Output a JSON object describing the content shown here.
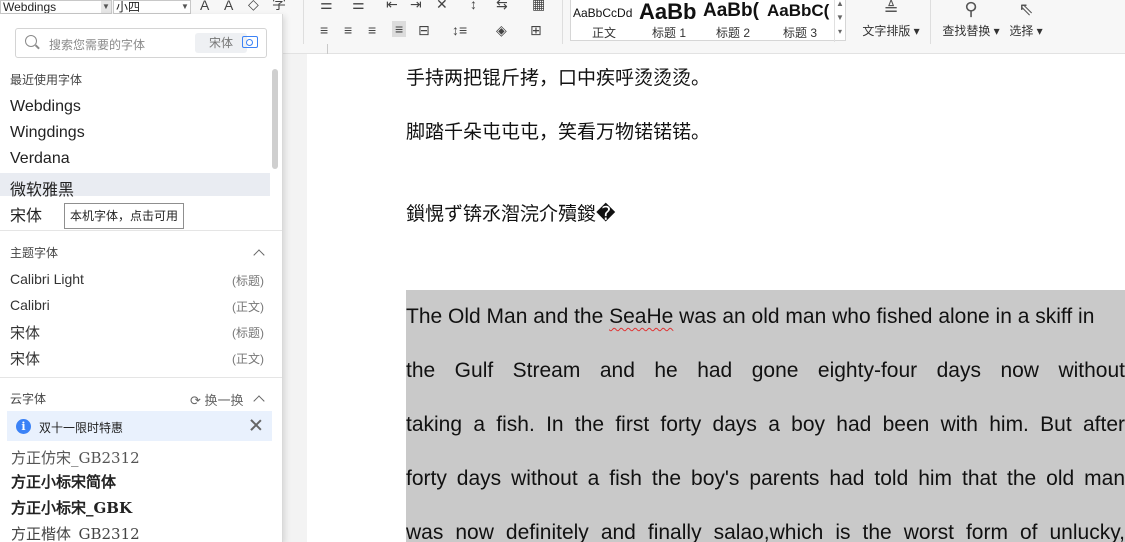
{
  "ribbon": {
    "font_name": "Webdings",
    "font_size": "小四",
    "styles": [
      {
        "preview": "AaBbCcDd",
        "label": "正文"
      },
      {
        "preview": "AaBb",
        "label": "标题 1"
      },
      {
        "preview": "AaBb(",
        "label": "标题 2"
      },
      {
        "preview": "AaBbC(",
        "label": "标题 3"
      }
    ],
    "text_layout_label": "文字排版",
    "find_replace_label": "查找替换",
    "select_label": "选择"
  },
  "font_panel": {
    "search_placeholder": "搜索您需要的字体",
    "search_chip": "宋体",
    "recent_title": "最近使用字体",
    "recent_fonts": [
      "Webdings",
      "Wingdings",
      "Verdana",
      "微软雅黑",
      "宋体"
    ],
    "tooltip": "本机字体，点击可用",
    "theme_title": "主题字体",
    "theme_fonts": [
      {
        "name": "Calibri Light",
        "tag": "(标题)"
      },
      {
        "name": "Calibri",
        "tag": "(正文)"
      },
      {
        "name": "宋体",
        "tag": "(标题)"
      },
      {
        "name": "宋体",
        "tag": "(正文)"
      }
    ],
    "cloud_title": "云字体",
    "cloud_refresh": "换一换",
    "promo_text": "双十一限时特惠",
    "cloud_fonts": [
      "方正仿宋_GB2312",
      "方正小标宋简体",
      "方正小标宋_GBK",
      "方正楷体_GB2312"
    ]
  },
  "document": {
    "cn_lines": [
      "手持两把锟斤拷，口中疾呼烫烫烫。",
      "脚踏千朵屯屯屯，笑看万物锘锘锘。",
      "鎻愰ず锛氶潪浣介殰鍐�"
    ],
    "en_first_word": "The Old Man and the ",
    "en_squiggle": "SeaHe",
    "en_first_rest": " was an old man who fished alone in a skiff in",
    "en_lines": [
      "the Gulf Stream     and he had gone eighty-four days     now without",
      "taking a fish. In the first forty days a boy had been with him. But after",
      "forty days without a fish the boy's parents had told him that the old man",
      "was now definitely and finally salao,which     is the worst form of unlucky,"
    ]
  }
}
